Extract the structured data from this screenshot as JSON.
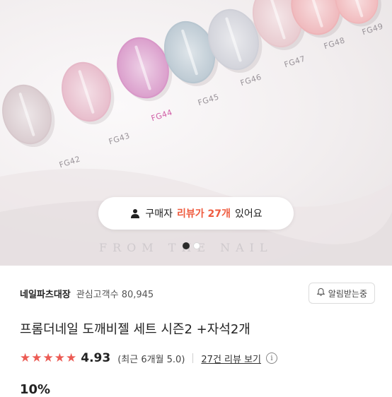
{
  "hero": {
    "nails": [
      {
        "label": "FG42",
        "color": "#d7c8cc"
      },
      {
        "label": "FG43",
        "color": "#e6b8c8"
      },
      {
        "label": "FG44",
        "color": "#d897c8"
      },
      {
        "label": "FG45",
        "color": "#b8c6d0"
      },
      {
        "label": "FG46",
        "color": "#cfd0d8"
      },
      {
        "label": "FG47",
        "color": "#e7c7cc"
      },
      {
        "label": "FG48",
        "color": "#eeb3b7"
      },
      {
        "label": "FG49",
        "color": "#f0b5b8"
      }
    ],
    "highlight_label_color": "#d15fa7",
    "review_prefix": "구매자",
    "review_highlight": "리뷰가 27개",
    "review_suffix": "있어요",
    "watermark": "FROM THE NAIL",
    "carousel": {
      "total": 2,
      "active": 1
    }
  },
  "seller": {
    "name": "네일파츠대장",
    "watch_label": "관심고객수 80,945",
    "follow_label": "알림받는중"
  },
  "product": {
    "title": "프롬더네일 도깨비젤 세트 시즌2 +자석2개",
    "rating": "4.93",
    "stars": 5,
    "recent_rating": "(최근 6개월 5.0)",
    "review_link": "27건 리뷰 보기",
    "info_icon": "info-icon",
    "discount_partial": "10%"
  },
  "colors": {
    "accent": "#ef5b3f",
    "star": "#ec5b54"
  }
}
